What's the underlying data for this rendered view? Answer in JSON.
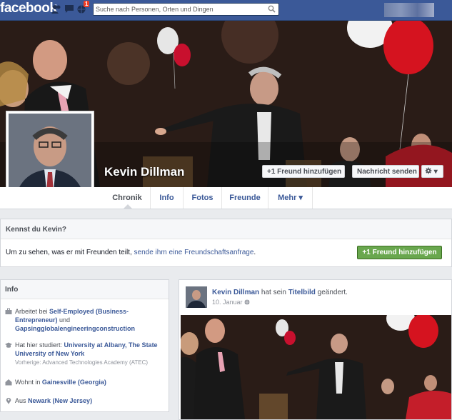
{
  "topbar": {
    "logo": "facebook",
    "notifications_count": "1",
    "search_placeholder": "Suche nach Personen, Orten und Dingen"
  },
  "profile": {
    "name": "Kevin Dillman",
    "add_friend_label": "+1 Freund hinzufügen",
    "message_label": "Nachricht senden",
    "gear_label": "▾"
  },
  "nav": {
    "tabs": [
      {
        "label": "Chronik"
      },
      {
        "label": "Info"
      },
      {
        "label": "Fotos"
      },
      {
        "label": "Freunde"
      },
      {
        "label": "Mehr ▾"
      }
    ]
  },
  "kennst": {
    "title": "Kennst du Kevin?",
    "text": "Um zu sehen, was er mit Freunden teilt, ",
    "link": "sende ihm eine Freundschaftsanfrage",
    "text_end": ".",
    "button": "+1 Freund hinzufügen"
  },
  "info": {
    "title": "Info",
    "work_prefix": "Arbeitet bei ",
    "work_company": "Self-Employed (Business-Entrepreneur)",
    "work_and": " und ",
    "work_company2": "Gapsingglobalengineeringconstruction",
    "study_prefix": "Hat hier studiert: ",
    "study_school": "University at Albany, The State University of New York",
    "study_prev": "Vorherige: Advanced Technologies Academy (ATEC)",
    "lives_prefix": "Wohnt in ",
    "lives_city": "Gainesville (Georgia)",
    "from_prefix": "Aus ",
    "from_city": "Newark (New Jersey)"
  },
  "post": {
    "author": "Kevin Dillman",
    "action": " hat sein ",
    "object": "Titelbild",
    "action_end": " geändert.",
    "date": "10. Januar"
  },
  "colors": {
    "brand": "#3b5998",
    "green": "#69a74e"
  }
}
